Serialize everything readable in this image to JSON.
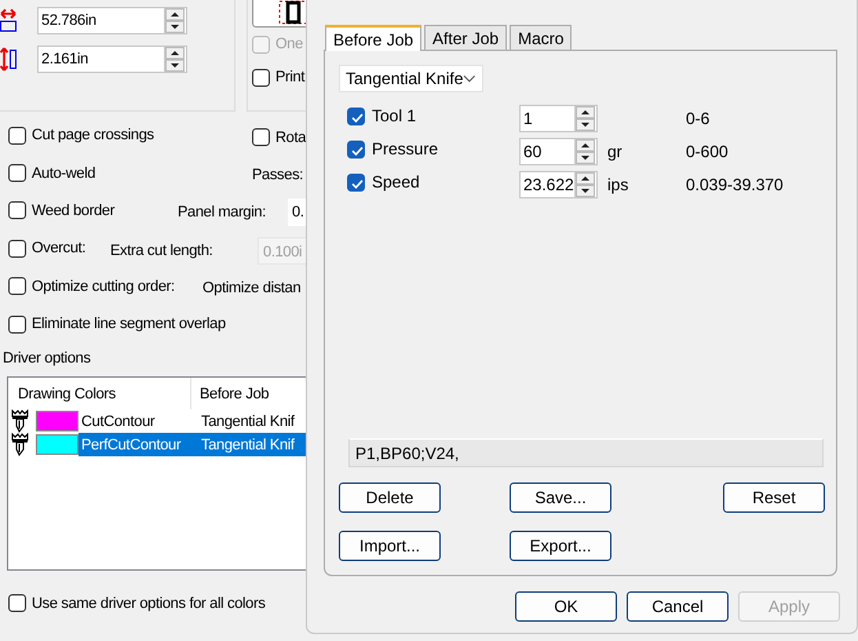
{
  "cut_settings": {
    "size_fields": [
      {
        "kind": "width",
        "value": "52.786in"
      },
      {
        "kind": "height",
        "value": "2.161in"
      }
    ],
    "side_options": [
      {
        "label": "One",
        "checked": false,
        "disabled": true
      },
      {
        "label": "Print",
        "checked": false,
        "disabled": false
      }
    ],
    "options": [
      {
        "label": "Cut page crossings",
        "checked": false,
        "side": {
          "kind": "checkbox",
          "label": "Rota",
          "checked": false
        }
      },
      {
        "label": "Auto-weld",
        "checked": false,
        "side": {
          "kind": "label",
          "label": "Passes:"
        }
      },
      {
        "label": "Weed border",
        "checked": false,
        "side": {
          "kind": "field",
          "label": "Panel margin:",
          "value": "0.",
          "disabled": false
        }
      },
      {
        "label": "Overcut:",
        "checked": false,
        "side": {
          "kind": "field",
          "label": "Extra cut length:",
          "value": "0.100i",
          "disabled": true
        }
      },
      {
        "label": "Optimize cutting order:",
        "checked": false,
        "side": {
          "kind": "label",
          "label": "Optimize distan"
        }
      },
      {
        "label": "Eliminate line segment overlap",
        "checked": false
      }
    ],
    "driver_options": {
      "title": "Driver options",
      "columns": [
        "Drawing Colors",
        "Before Job"
      ],
      "rows": [
        {
          "color": "#ff00ff",
          "name": "CutContour",
          "before_job": "Tangential Knif",
          "selected": false
        },
        {
          "color": "#00ffff",
          "name": "PerfCutContour",
          "before_job": "Tangential Knif",
          "selected": true
        }
      ]
    },
    "same_options": {
      "label": "Use same driver options for all colors",
      "checked": false
    }
  },
  "job_dialog": {
    "tabs": [
      {
        "label": "Before Job",
        "selected": true
      },
      {
        "label": "After Job",
        "selected": false
      },
      {
        "label": "Macro",
        "selected": false
      }
    ],
    "tool": "Tangential Knife",
    "parameters": [
      {
        "label": "Tool 1",
        "checked": true,
        "value": "1",
        "range": "0-6"
      },
      {
        "label": "Pressure",
        "checked": true,
        "value": "60",
        "unit": "gr",
        "range": "0-600"
      },
      {
        "label": "Speed",
        "checked": true,
        "value": "23.622",
        "unit": "ips",
        "range": "0.039-39.370"
      }
    ],
    "command": "P1,BP60;V24,",
    "action_buttons": [
      {
        "label": "Delete"
      },
      {
        "label": "Save..."
      },
      {
        "label": "Reset"
      },
      {
        "label": "Import..."
      },
      {
        "label": "Export..."
      }
    ],
    "buttons": [
      {
        "label": "OK",
        "disabled": false
      },
      {
        "label": "Cancel",
        "disabled": false
      },
      {
        "label": "Apply",
        "disabled": true
      }
    ]
  }
}
